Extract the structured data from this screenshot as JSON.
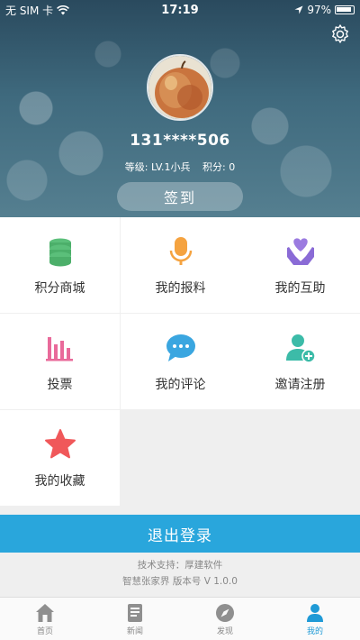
{
  "status_bar": {
    "carrier": "无 SIM 卡",
    "time": "17:19",
    "battery": "97%"
  },
  "profile": {
    "username": "131****506",
    "level": "等级: LV.1小兵",
    "points": "积分: 0",
    "checkin_label": "签到"
  },
  "menu": [
    {
      "label": "积分商城",
      "icon": "database-icon"
    },
    {
      "label": "我的报料",
      "icon": "microphone-icon"
    },
    {
      "label": "我的互助",
      "icon": "heart-hands-icon"
    },
    {
      "label": "投票",
      "icon": "bar-chart-icon"
    },
    {
      "label": "我的评论",
      "icon": "chat-bubble-icon"
    },
    {
      "label": "邀请注册",
      "icon": "add-user-icon"
    },
    {
      "label": "我的收藏",
      "icon": "star-icon"
    }
  ],
  "logout_label": "退出登录",
  "footer": {
    "support": "技术支持：厚建软件",
    "version": "智慧张家界 版本号 V 1.0.0"
  },
  "tabs": [
    {
      "label": "首页",
      "icon": "home-icon"
    },
    {
      "label": "新闻",
      "icon": "news-icon"
    },
    {
      "label": "发现",
      "icon": "compass-icon"
    },
    {
      "label": "我的",
      "icon": "user-icon"
    }
  ],
  "colors": {
    "accent": "#29a6dc",
    "active_tab": "#1f9ad6"
  }
}
